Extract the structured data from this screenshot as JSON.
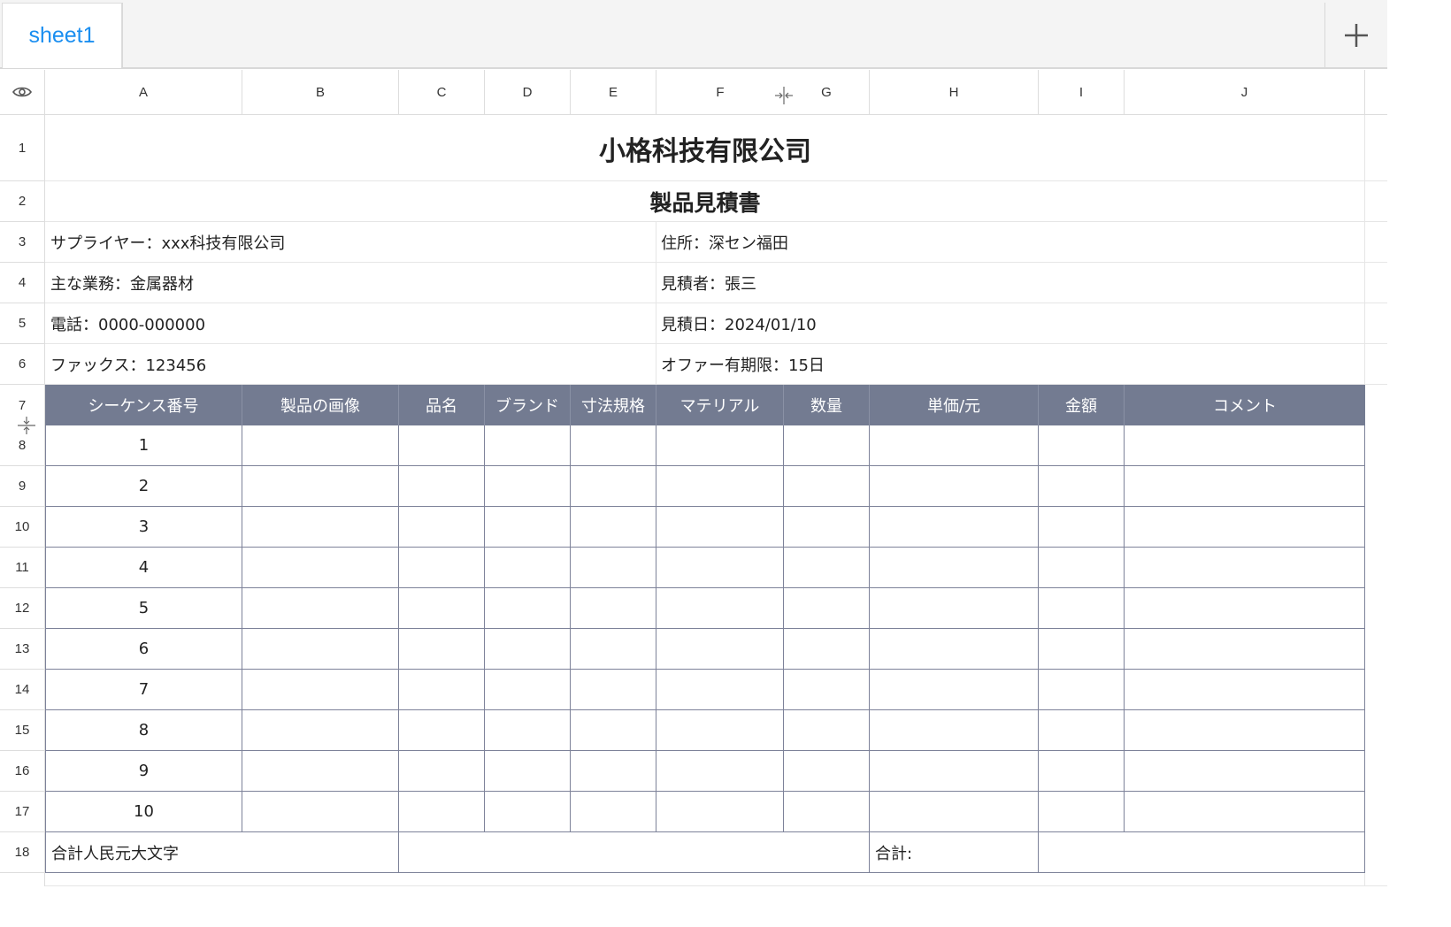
{
  "tabs": {
    "active_tab": "sheet1",
    "add_icon": "plus-icon"
  },
  "columns": [
    "A",
    "B",
    "C",
    "D",
    "E",
    "F",
    "G",
    "H",
    "I",
    "J"
  ],
  "rows": [
    "1",
    "2",
    "3",
    "4",
    "5",
    "6",
    "7",
    "8",
    "9",
    "10",
    "11",
    "12",
    "13",
    "14",
    "15",
    "16",
    "17",
    "18"
  ],
  "sheet": {
    "title": "小格科技有限公司",
    "subtitle": "製品見積書",
    "info_left": [
      "サプライヤー：xxx科技有限公司",
      "主な業務：金属器材",
      "電話：0000-000000",
      "ファックス：123456"
    ],
    "info_right": [
      "住所：深セン福田",
      "見積者：張三",
      "見積日：2024/01/10",
      "オファー有期限：15日"
    ],
    "table_headers": [
      "シーケンス番号",
      "製品の画像",
      "品名",
      "ブランド",
      "寸法規格",
      "マテリアル",
      "数量",
      "単価/元",
      "金額",
      "コメント"
    ],
    "sequence": [
      "1",
      "2",
      "3",
      "4",
      "5",
      "6",
      "7",
      "8",
      "9",
      "10"
    ],
    "total_words_label": "合計人民元大文字",
    "total_label": "合計:"
  },
  "colors": {
    "header_fill": "#737b91",
    "tab_text": "#1a8ef0",
    "table_border": "#7d8299"
  }
}
